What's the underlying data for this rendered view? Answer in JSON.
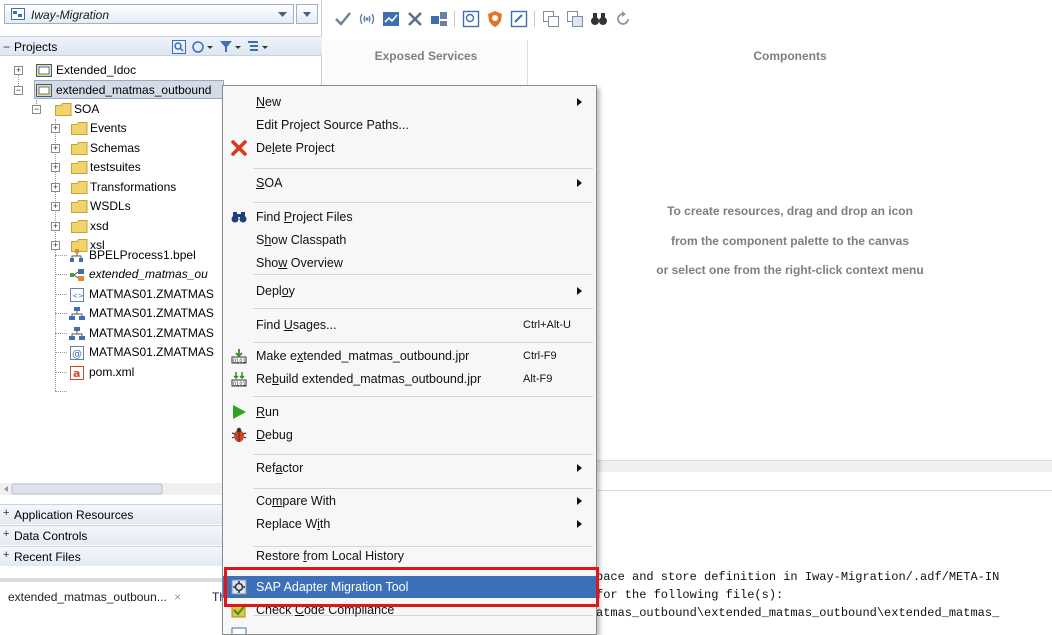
{
  "app": {
    "name": "Iway-Migration"
  },
  "navigator": {
    "projects_label": "Projects",
    "tree": [
      {
        "label": "Extended_Idoc",
        "type": "project",
        "italic": false
      },
      {
        "label": "extended_matmas_outbound",
        "type": "project",
        "italic": false
      },
      {
        "label": "SOA",
        "type": "folder",
        "italic": false
      },
      {
        "label": "Events",
        "type": "folder",
        "italic": false
      },
      {
        "label": "Schemas",
        "type": "folder",
        "italic": false
      },
      {
        "label": "testsuites",
        "type": "folder",
        "italic": false
      },
      {
        "label": "Transformations",
        "type": "folder",
        "italic": false
      },
      {
        "label": "WSDLs",
        "type": "folder",
        "italic": false
      },
      {
        "label": "xsd",
        "type": "folder",
        "italic": false
      },
      {
        "label": "xsl",
        "type": "folder",
        "italic": false
      },
      {
        "label": "BPELProcess1.bpel",
        "type": "bpel",
        "italic": false
      },
      {
        "label": "extended_matmas_ou",
        "type": "composite",
        "italic": true
      },
      {
        "label": "MATMAS01.ZMATMAS",
        "type": "xml",
        "italic": false
      },
      {
        "label": "MATMAS01.ZMATMAS",
        "type": "schema",
        "italic": false
      },
      {
        "label": "MATMAS01.ZMATMAS",
        "type": "schema",
        "italic": false
      },
      {
        "label": "MATMAS01.ZMATMAS",
        "type": "wsdl",
        "italic": false
      },
      {
        "label": "pom.xml",
        "type": "maven",
        "italic": false
      }
    ],
    "accordions": [
      "Application Resources",
      "Data Controls",
      "Recent Files"
    ],
    "bottom_tab": "extended_matmas_outboun...",
    "bottom_tab_close": "×",
    "bottom_tab2": "Th"
  },
  "canvas": {
    "exposed_services": "Exposed Services",
    "components": "Components",
    "hint_lines": [
      "To create resources, drag and drop an icon",
      "from the component palette to the canvas",
      "or select one from the right-click context menu"
    ]
  },
  "log": {
    "lines": [
      "pace and store definition in Iway-Migration/.adf/META-IN",
      "for the following file(s):",
      "atmas_outbound\\extended_matmas_outbound\\extended_matmas_"
    ]
  },
  "context_menu": {
    "items": [
      {
        "pre": "",
        "u": "N",
        "post": "ew",
        "shortcut": "",
        "submenu": true,
        "icon": ""
      },
      {
        "pre": "Edit Project Source Paths...",
        "u": "",
        "post": "",
        "shortcut": "",
        "submenu": false,
        "icon": ""
      },
      {
        "pre": "De",
        "u": "l",
        "post": "ete Project",
        "shortcut": "",
        "submenu": false,
        "icon": "delete-icon"
      },
      {
        "pre": "",
        "u": "S",
        "post": "OA",
        "shortcut": "",
        "submenu": true,
        "icon": ""
      },
      {
        "pre": "Find ",
        "u": "P",
        "post": "roject Files",
        "shortcut": "",
        "submenu": false,
        "icon": "binoculars-icon"
      },
      {
        "pre": "S",
        "u": "h",
        "post": "ow Classpath",
        "shortcut": "",
        "submenu": false,
        "icon": ""
      },
      {
        "pre": "Sho",
        "u": "w",
        "post": " Overview",
        "shortcut": "",
        "submenu": false,
        "icon": ""
      },
      {
        "pre": "Depl",
        "u": "o",
        "post": "y",
        "shortcut": "",
        "submenu": true,
        "icon": ""
      },
      {
        "pre": "Find ",
        "u": "U",
        "post": "sages...",
        "shortcut": "Ctrl+Alt-U",
        "submenu": false,
        "icon": ""
      },
      {
        "pre": "Make e",
        "u": "x",
        "post": "tended_matmas_outbound.jpr",
        "shortcut": "Ctrl-F9",
        "submenu": false,
        "icon": "make-icon"
      },
      {
        "pre": "Re",
        "u": "b",
        "post": "uild extended_matmas_outbound.jpr",
        "shortcut": "Alt-F9",
        "submenu": false,
        "icon": "rebuild-icon"
      },
      {
        "pre": "",
        "u": "R",
        "post": "un",
        "shortcut": "",
        "submenu": false,
        "icon": "run-icon"
      },
      {
        "pre": "",
        "u": "D",
        "post": "ebug",
        "shortcut": "",
        "submenu": false,
        "icon": "debug-icon"
      },
      {
        "pre": "Ref",
        "u": "a",
        "post": "ctor",
        "shortcut": "",
        "submenu": true,
        "icon": ""
      },
      {
        "pre": "Co",
        "u": "m",
        "post": "pare With",
        "shortcut": "",
        "submenu": true,
        "icon": ""
      },
      {
        "pre": "Replace W",
        "u": "i",
        "post": "th",
        "shortcut": "",
        "submenu": true,
        "icon": ""
      },
      {
        "pre": "Restore ",
        "u": "f",
        "post": "rom Local History",
        "shortcut": "",
        "submenu": false,
        "icon": ""
      },
      {
        "pre": "SAP Adapter Migration Tool",
        "u": "",
        "post": "",
        "shortcut": "",
        "submenu": false,
        "icon": "sap-adapter-icon"
      },
      {
        "pre": "Check ",
        "u": "C",
        "post": "ode Compliance",
        "shortcut": "",
        "submenu": false,
        "icon": "compliance-icon"
      }
    ],
    "highlighted_item": "SAP Adapter Migration Tool"
  },
  "colors": {
    "menu_highlight": "#3c70b8",
    "callout_border": "#e0161b",
    "folder_yellow": "#f1d36b",
    "hint_text": "#7f7f7f"
  }
}
